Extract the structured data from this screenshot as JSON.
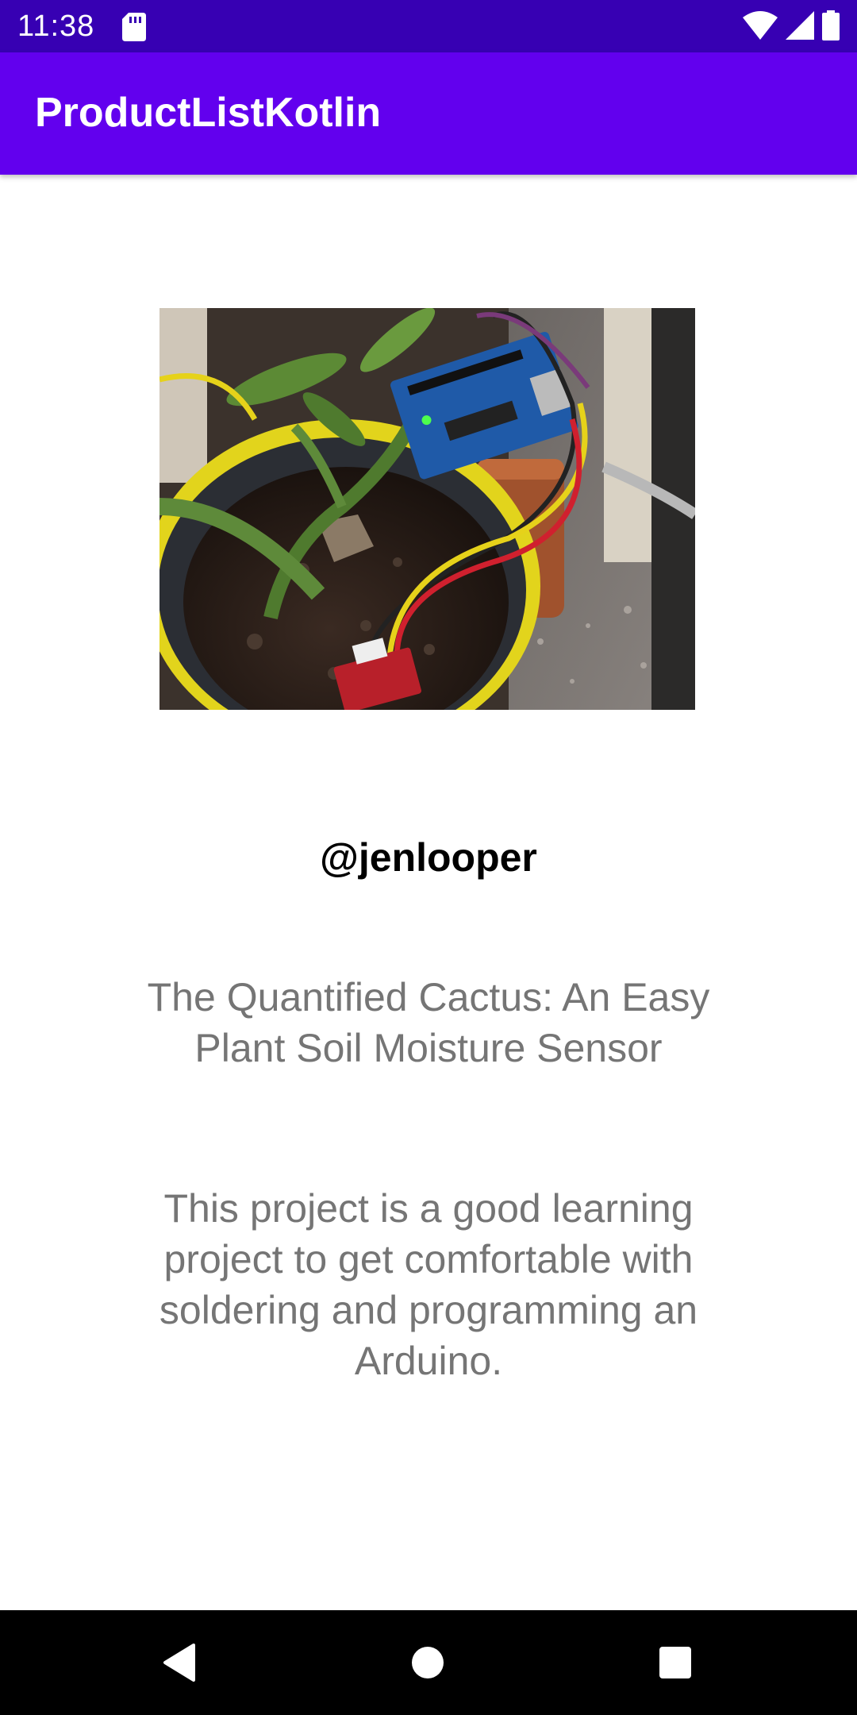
{
  "status_bar": {
    "time": "11:38",
    "icons": [
      "sd-card-icon",
      "wifi-icon",
      "signal-icon",
      "battery-icon"
    ]
  },
  "app_bar": {
    "title": "ProductListKotlin",
    "color": "#6200ee",
    "status_color": "#3700b3"
  },
  "product": {
    "image_alt": "Plant pot with soil moisture sensor wired to an Arduino board",
    "username": "@jenlooper",
    "title": "The Quantified Cactus: An Easy Plant Soil Moisture Sensor",
    "description": "This project is a good learning project to get comfortable with soldering and programming an Arduino."
  },
  "nav_bar": {
    "buttons": [
      "back-icon",
      "home-icon",
      "recents-icon"
    ]
  }
}
